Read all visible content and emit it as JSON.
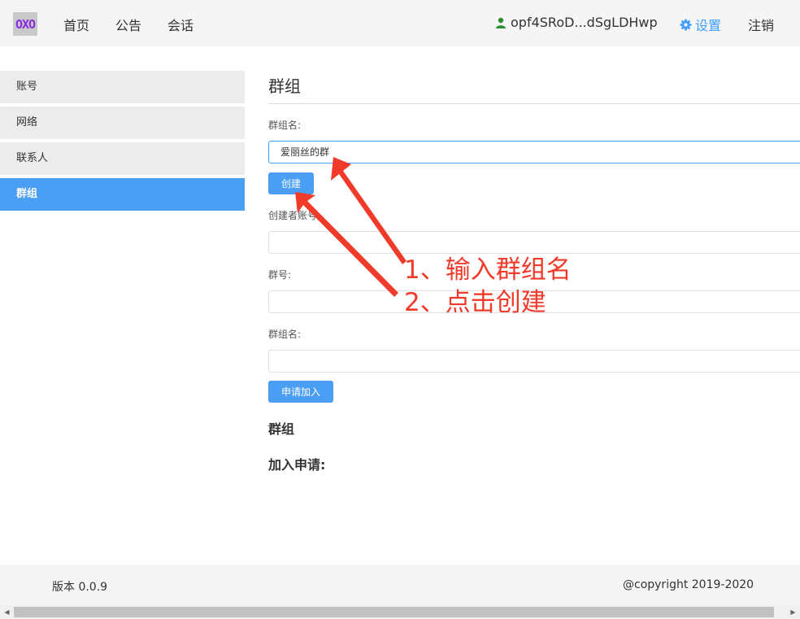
{
  "header": {
    "logo_text": "OXO",
    "nav": [
      "首页",
      "公告",
      "会话"
    ],
    "user_name": "opf4SRoD...dSgLDHwp",
    "settings_label": "设置",
    "logout_label": "注销"
  },
  "sidebar": {
    "items": [
      {
        "label": "账号",
        "active": false
      },
      {
        "label": "网络",
        "active": false
      },
      {
        "label": "联系人",
        "active": false
      },
      {
        "label": "群组",
        "active": true
      }
    ]
  },
  "main": {
    "title": "群组",
    "create": {
      "name_label": "群组名:",
      "name_value": "爱丽丝的群",
      "create_button": "创建"
    },
    "join": {
      "creator_label": "创建者账号:",
      "creator_value": "",
      "group_id_label": "群号:",
      "group_id_value": "",
      "group_name_label": "群组名:",
      "group_name_value": "",
      "join_button": "申请加入"
    },
    "groups_heading": "群组",
    "requests_heading": "加入申请:"
  },
  "annotations": {
    "step1": "1、输入群组名",
    "step2": "2、点击创建",
    "color": "#f03a2a"
  },
  "footer": {
    "version": "版本 0.0.9",
    "copyright": "@copyright 2019-2020"
  },
  "colors": {
    "accent": "#4a9ff5",
    "link": "#409eff",
    "user_icon": "#2e8b2e"
  }
}
